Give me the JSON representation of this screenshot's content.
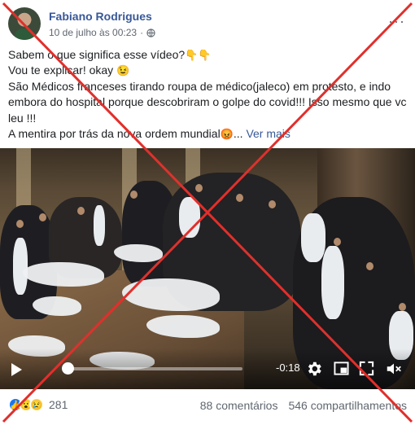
{
  "post": {
    "author": "Fabiano Rodrigues",
    "timestamp": "10 de julho às 00:23",
    "separator": "·",
    "privacy_icon": "globe-icon",
    "more_icon": "more-options-icon"
  },
  "body": {
    "line1": "Sabem o que significa esse vídeo?",
    "line1_emoji": "👇👇",
    "line2": "Vou te explicar! okay ",
    "line2_emoji": "😉",
    "line3": "São Médicos franceses tirando roupa de médico(jaleco) em protesto, e indo embora do hospital porque descobriram o golpe do covid!!! Isso mesmo que vc leu !!!",
    "line4": "A mentira por trás da nova ordem mundial",
    "line4_emoji": "😡",
    "ellipsis": "... ",
    "see_more": "Ver mais"
  },
  "video": {
    "time_remaining": "-0:18",
    "progress": 0.0,
    "icons": [
      "play-icon",
      "gear-icon",
      "pip-icon",
      "fullscreen-icon",
      "volume-icon"
    ]
  },
  "footer": {
    "reaction_icons": [
      "like-icon",
      "wow-icon",
      "sad-icon"
    ],
    "reaction_count": "281",
    "comments": "88 comentários",
    "shares": "546 compartilhamentos"
  },
  "colors": {
    "author_link": "#385898",
    "cross_overlay": "#e0302c",
    "like_blue": "#1877f2"
  }
}
